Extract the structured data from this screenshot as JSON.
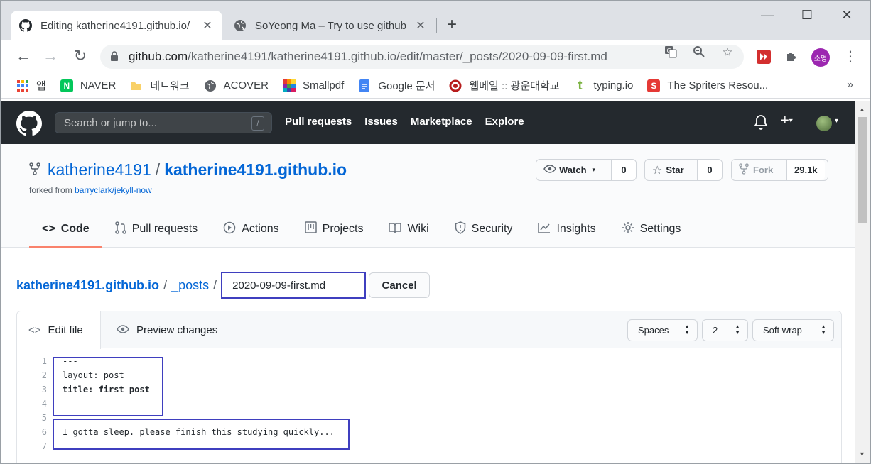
{
  "browser": {
    "tabs": [
      {
        "title": "Editing katherine4191.github.io/",
        "active": true
      },
      {
        "title": "SoYeong Ma – Try to use github",
        "active": false
      }
    ],
    "url_host": "github.com",
    "url_path": "/katherine4191/katherine4191.github.io/edit/master/_posts/2020-09-09-first.md",
    "profile_label": "소영",
    "bookmarks": [
      {
        "label": "앱",
        "icon": "apps-grid-icon"
      },
      {
        "label": "NAVER",
        "icon": "naver-icon"
      },
      {
        "label": "네트워크",
        "icon": "folder-icon"
      },
      {
        "label": "ACOVER",
        "icon": "globe-icon"
      },
      {
        "label": "Smallpdf",
        "icon": "smallpdf-icon"
      },
      {
        "label": "Google 문서",
        "icon": "google-docs-icon"
      },
      {
        "label": "웹메일 :: 광운대학교",
        "icon": "university-seal-icon"
      },
      {
        "label": "typing.io",
        "icon": "typing-icon"
      },
      {
        "label": "The Spriters Resou...",
        "icon": "spriters-icon"
      }
    ]
  },
  "github": {
    "search_placeholder": "Search or jump to...",
    "search_shortcut": "/",
    "nav": [
      "Pull requests",
      "Issues",
      "Marketplace",
      "Explore"
    ],
    "repo_owner": "katherine4191",
    "repo_name": "katherine4191.github.io",
    "forked_prefix": "forked from ",
    "forked_from": "barryclark/jekyll-now",
    "watch": {
      "label": "Watch",
      "count": "0"
    },
    "star": {
      "label": "Star",
      "count": "0"
    },
    "fork": {
      "label": "Fork",
      "count": "29.1k"
    },
    "tabs": [
      {
        "label": "Code",
        "icon": "code-icon"
      },
      {
        "label": "Pull requests",
        "icon": "pull-request-icon"
      },
      {
        "label": "Actions",
        "icon": "play-icon"
      },
      {
        "label": "Projects",
        "icon": "project-icon"
      },
      {
        "label": "Wiki",
        "icon": "book-icon"
      },
      {
        "label": "Security",
        "icon": "shield-icon"
      },
      {
        "label": "Insights",
        "icon": "graph-icon"
      },
      {
        "label": "Settings",
        "icon": "gear-icon"
      }
    ],
    "breadcrumb": {
      "repo": "katherine4191.github.io",
      "folder": "_posts",
      "sep": "/"
    },
    "filename": "2020-09-09-first.md",
    "cancel_label": "Cancel",
    "editor": {
      "edit_tab": "Edit file",
      "preview_tab": "Preview changes",
      "indent_mode": "Spaces",
      "indent_size": "2",
      "wrap_mode": "Soft wrap",
      "lines": [
        {
          "n": "1",
          "text": "---",
          "bold": false
        },
        {
          "n": "2",
          "text": "layout: post",
          "bold": false
        },
        {
          "n": "3",
          "text": "title: first post",
          "bold": true
        },
        {
          "n": "4",
          "text": "---",
          "bold": false
        },
        {
          "n": "5",
          "text": "",
          "bold": false
        },
        {
          "n": "6",
          "text": "I gotta sleep. please finish this studying quickly...",
          "bold": false
        },
        {
          "n": "7",
          "text": "",
          "bold": false
        }
      ]
    }
  },
  "colors": {
    "header_bg": "#24292e",
    "link": "#0366d6",
    "tab_underline": "#f9826c",
    "highlight_box": "#3f3fbf"
  }
}
